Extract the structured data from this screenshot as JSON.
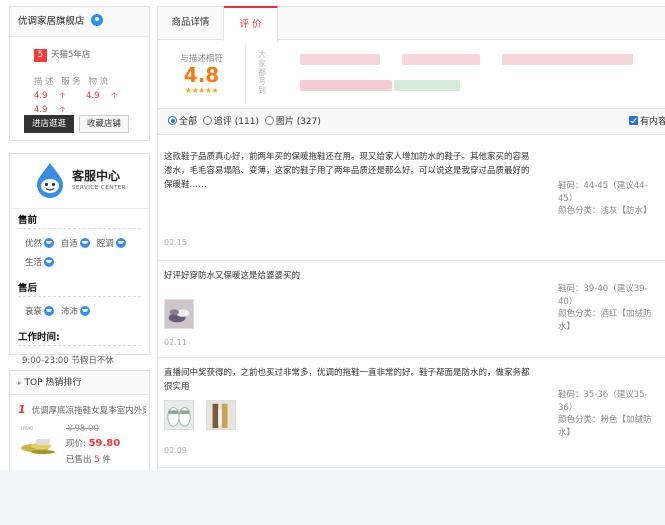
{
  "shop": {
    "name": "优调家居旗舰店",
    "year_num": "5",
    "year_label": "天猫5年店",
    "score_labels": [
      "描述",
      "服务",
      "物流"
    ],
    "score_values": [
      "4.9",
      "4.9",
      "4.9"
    ],
    "enter_label": "进店逛逛",
    "fav_label": "收藏店铺"
  },
  "service": {
    "name": "客服中心",
    "en": "SERVICE CENTER",
    "presale_title": "售前",
    "presale_agents": [
      "优然",
      "自适",
      "腔调",
      "生活"
    ],
    "aftersale_title": "售后",
    "aftersale_agents": [
      "衰衰",
      "沛沛"
    ],
    "worktime_title": "工作时间:",
    "worktime": "9:00-23:00 节假日不休"
  },
  "top": {
    "title": "TOP 热销排行",
    "rank": "1",
    "item_name": "优调厚底凉拖鞋女夏季室内外穿",
    "price_old": "￥98.00",
    "price_now_label": "现价:",
    "price_now": "59.80",
    "sold_prefix": "已售出",
    "sold_count": "5",
    "sold_suffix": "件"
  },
  "tabs": {
    "detail": "商品详情",
    "review": "评 价"
  },
  "summary": {
    "match_label": "与描述相符",
    "match_score": "4.8",
    "stars": "★★★★★",
    "impression_label": "大家都写到"
  },
  "filter": {
    "all": "全部",
    "append": "追评 (111)",
    "pics": "图片 (327)",
    "has_content": "有内容"
  },
  "reviews": [
    {
      "text": "这款鞋子品质真心好，前两年买的保暖拖鞋还在用。现又给家人增加防水的鞋子。其他家买的容易渗水，毛毛容易塌陷、变薄，这家的鞋子用了两年品质还是那么好。可以说这是我穿过品质最好的保暖鞋……",
      "date": "02.15",
      "size": "鞋码：44-45（建议44-45）",
      "color": "颜色分类：浅灰【防水】"
    },
    {
      "text": "好评好穿防水又保暖这是给婆婆买的",
      "date": "02.11",
      "size": "鞋码：39-40（建议39-40）",
      "color": "颜色分类：酒红【加绒防水】"
    },
    {
      "text": "直播间中奖获得的，之前也买过非常多，优调的拖鞋一直非常的好。鞋子帮面是防水的，做家务都很实用",
      "date": "02.09",
      "size": "鞋码：35-36（建议35-36）",
      "color": "颜色分类：粉色【加绒防水】"
    }
  ],
  "colors": {
    "accent": "#e4393c",
    "score": "#f27c1c",
    "link_blue": "#2f6fd6"
  }
}
